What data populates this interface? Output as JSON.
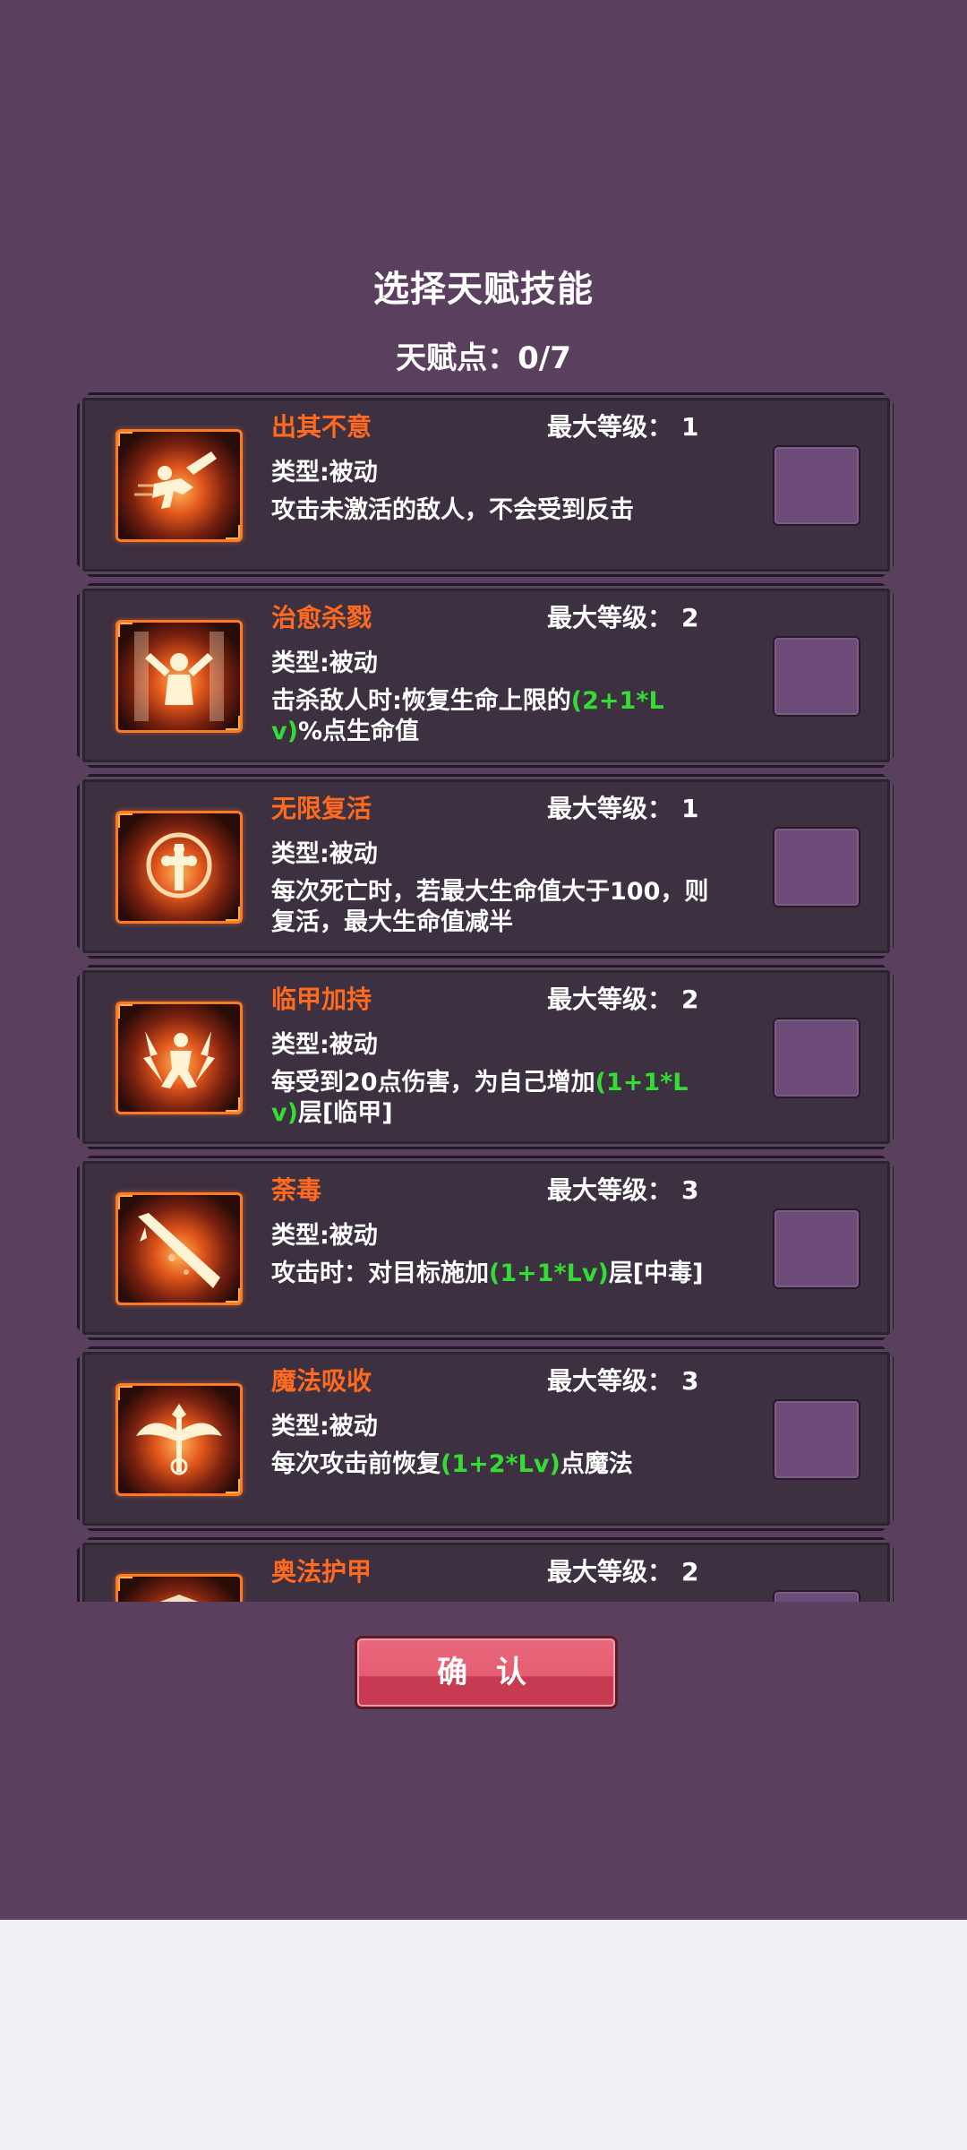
{
  "title": "选择天赋技能",
  "points": {
    "label": "天赋点：",
    "value": "0/7"
  },
  "max_level_label": "最大等级：",
  "skills": [
    {
      "name": "出其不意",
      "max_level": "1",
      "type": "类型:被动",
      "desc": [
        {
          "t": "攻击未激活的敌人，不会受到反击",
          "hl": false
        }
      ],
      "icon": "dash-strike-icon"
    },
    {
      "name": "治愈杀戮",
      "max_level": "2",
      "type": "类型:被动",
      "desc": [
        {
          "t": "击杀敌人时:恢复生命上限的",
          "hl": false
        },
        {
          "t": "(2+1*Lv)",
          "hl": true
        },
        {
          "t": "%点生命值",
          "hl": false
        }
      ],
      "icon": "heal-figure-icon"
    },
    {
      "name": "无限复活",
      "max_level": "1",
      "type": "类型:被动",
      "desc": [
        {
          "t": "每次死亡时，若最大生命值大于100，则复活，最大生命值减半",
          "hl": false
        }
      ],
      "icon": "cross-revive-icon"
    },
    {
      "name": "临甲加持",
      "max_level": "2",
      "type": "类型:被动",
      "desc": [
        {
          "t": "每受到20点伤害，为自己增加",
          "hl": false
        },
        {
          "t": "(1+1*Lv)",
          "hl": true
        },
        {
          "t": "层[临甲]",
          "hl": false
        }
      ],
      "icon": "lightning-figure-icon"
    },
    {
      "name": "荼毒",
      "max_level": "3",
      "type": "类型:被动",
      "desc": [
        {
          "t": "攻击时：对目标施加",
          "hl": false
        },
        {
          "t": "(1+1*Lv)",
          "hl": true
        },
        {
          "t": "层[中毒]",
          "hl": false
        }
      ],
      "icon": "poison-blade-icon"
    },
    {
      "name": "魔法吸收",
      "max_level": "3",
      "type": "类型:被动",
      "desc": [
        {
          "t": "每次攻击前恢复",
          "hl": false
        },
        {
          "t": "(1+2*Lv)",
          "hl": true
        },
        {
          "t": "点魔法",
          "hl": false
        }
      ],
      "icon": "winged-staff-icon"
    },
    {
      "name": "奥法护甲",
      "max_level": "2",
      "type": "",
      "desc": [],
      "icon": "arcane-armor-icon"
    }
  ],
  "confirm_label": "确 认"
}
